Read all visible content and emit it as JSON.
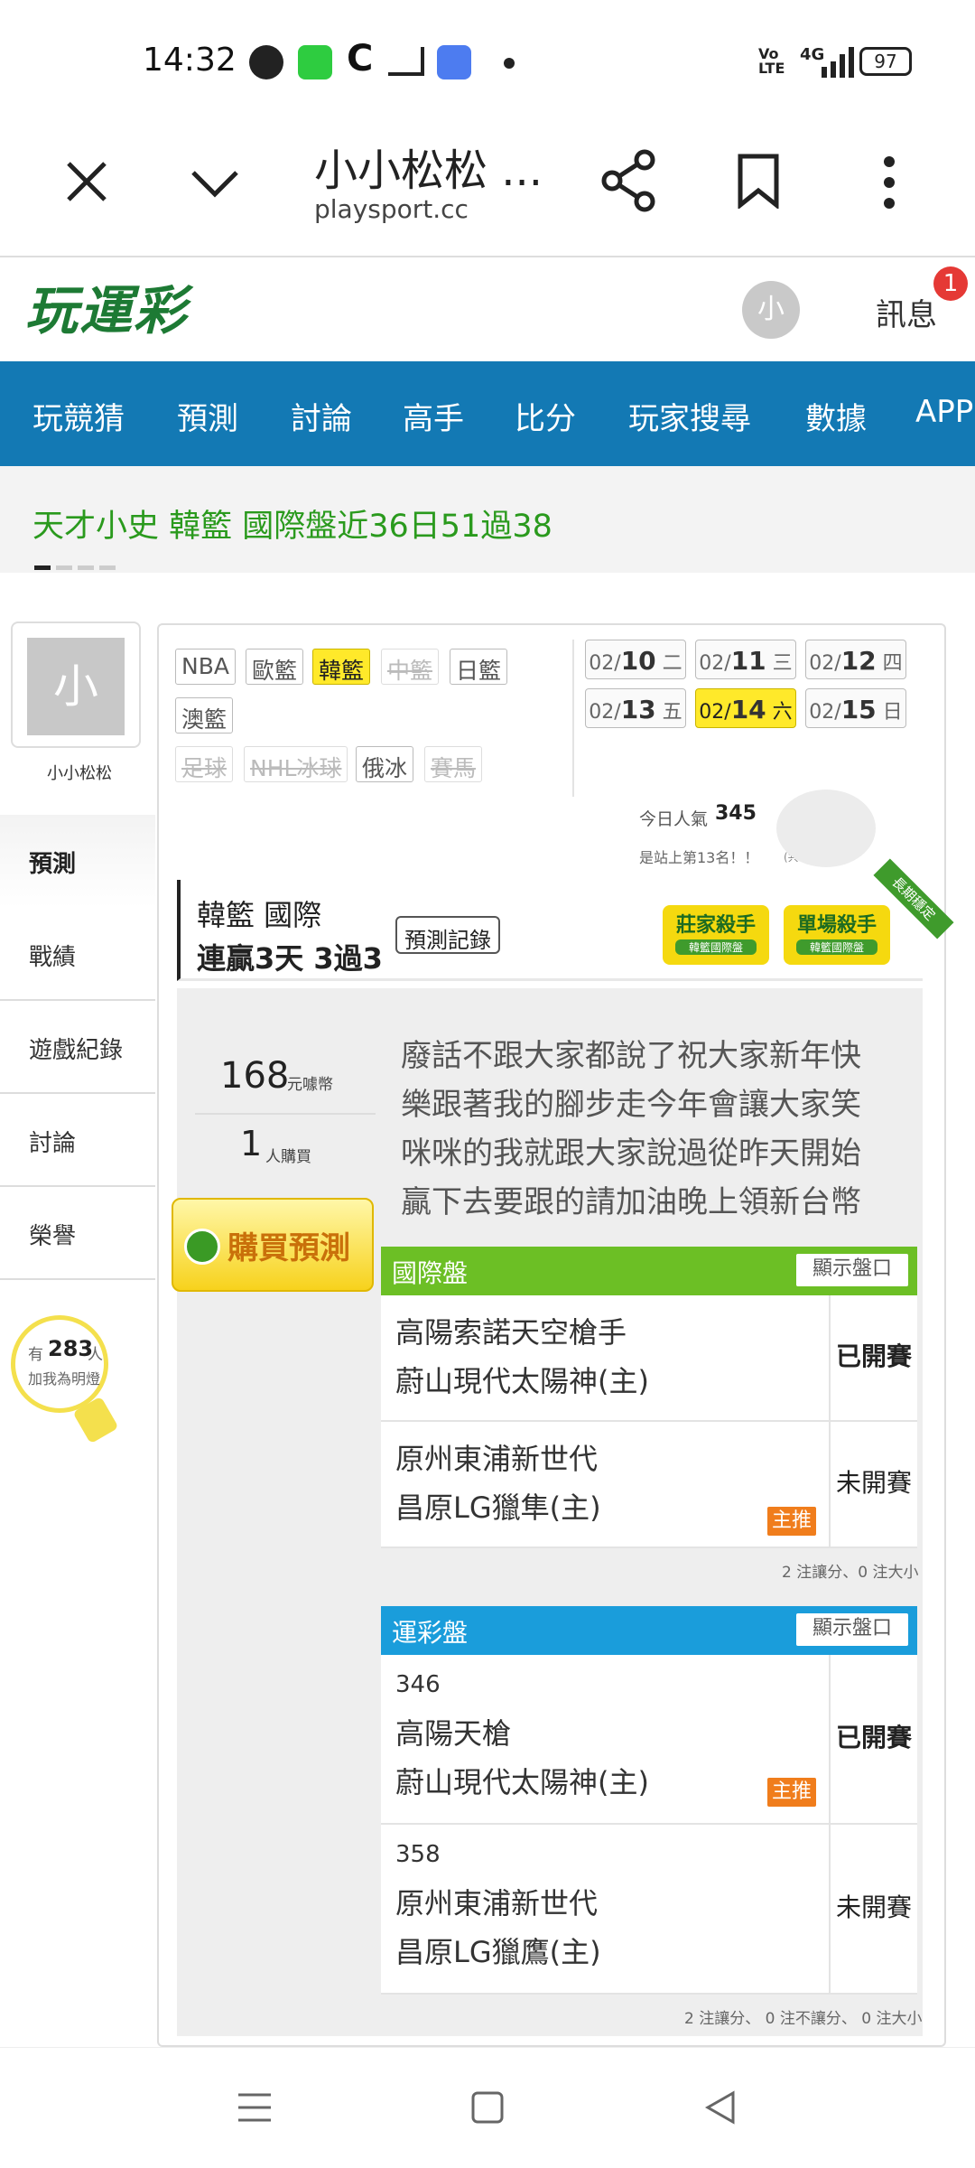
{
  "status_bar": {
    "time": "14:32",
    "battery": "97",
    "network": "4G"
  },
  "browser": {
    "title": "小小松松 ...",
    "url": "playsport.cc"
  },
  "site": {
    "logo": "玩運彩",
    "avatar_letter": "小",
    "messages_label": "訊息",
    "messages_count": "1"
  },
  "nav": {
    "items": [
      "玩競猜",
      "預測",
      "討論",
      "高手",
      "比分",
      "玩家搜尋",
      "數據",
      "APP"
    ]
  },
  "ticker": {
    "text": "天才小史  韓籃  國際盤近36日51過38"
  },
  "profile": {
    "avatar_letter": "小",
    "name": "小小松松"
  },
  "sidebar": {
    "items": [
      "預測",
      "戰績",
      "遊戲紀錄",
      "討論",
      "榮譽"
    ]
  },
  "fans": {
    "prefix": "有",
    "count": "283",
    "unit": "人",
    "label": "加我為明燈"
  },
  "leagues": [
    {
      "label": "NBA",
      "state": "normal"
    },
    {
      "label": "歐籃",
      "state": "normal"
    },
    {
      "label": "韓籃",
      "state": "selected"
    },
    {
      "label": "中籃",
      "state": "disabled"
    },
    {
      "label": "日籃",
      "state": "normal"
    },
    {
      "label": "澳籃",
      "state": "normal"
    },
    {
      "label": "足球",
      "state": "disabled"
    },
    {
      "label": "NHL冰球",
      "state": "disabled"
    },
    {
      "label": "俄冰",
      "state": "normal"
    },
    {
      "label": "賽馬",
      "state": "disabled"
    }
  ],
  "dates": [
    {
      "md": "02/",
      "day": "10",
      "wd": "二",
      "selected": false
    },
    {
      "md": "02/",
      "day": "11",
      "wd": "三",
      "selected": false
    },
    {
      "md": "02/",
      "day": "12",
      "wd": "四",
      "selected": false
    },
    {
      "md": "02/",
      "day": "13",
      "wd": "五",
      "selected": false
    },
    {
      "md": "02/",
      "day": "14",
      "wd": "六",
      "selected": true
    },
    {
      "md": "02/",
      "day": "15",
      "wd": "日",
      "selected": false
    }
  ],
  "popularity": {
    "label": "今日人氣",
    "value": "345",
    "rank_text": "是站上第13名！！",
    "rank_total": "(共6990人)"
  },
  "league_card": {
    "title": "韓籃 國際",
    "streak": "連贏3天 3過3",
    "record_button": "預測記錄",
    "badge1_top": "莊家殺手",
    "badge1_bottom": "韓籃國際盤",
    "badge2_top": "單場殺手",
    "badge2_bottom": "韓籃國際盤",
    "corner_label": "長期穩定"
  },
  "price": {
    "value": "168",
    "unit": "元噱幣",
    "buyers": "1",
    "buyers_unit": "人購買",
    "buy_button": "購買預測"
  },
  "message": "廢話不跟大家都說了祝大家新年快樂跟著我的腳步走今年會讓大家笑咪咪的我就跟大家說過從昨天開始贏下去要跟的請加油晚上領新台幣",
  "intl_board": {
    "title": "國際盤",
    "show_button": "顯示盤口",
    "rows": [
      {
        "team1": "高陽索諾天空槍手",
        "team2": "蔚山現代太陽神(主)",
        "status": "已開賽",
        "bold": true,
        "badge": ""
      },
      {
        "team1": "原州東浦新世代",
        "team2": "昌原LG獵隼(主)",
        "status": "未開賽",
        "bold": false,
        "badge": "主推"
      }
    ],
    "footer": "2 注讓分、0 注大小"
  },
  "lottery_board": {
    "title": "運彩盤",
    "show_button": "顯示盤口",
    "rows": [
      {
        "code": "346",
        "team1": "高陽天槍",
        "team2": "蔚山現代太陽神(主)",
        "status": "已開賽",
        "bold": true,
        "badge": "主推"
      },
      {
        "code": "358",
        "team1": "原州東浦新世代",
        "team2": "昌原LG獵鷹(主)",
        "status": "未開賽",
        "bold": false,
        "badge": ""
      }
    ],
    "footer": "2 注讓分、 0 注不讓分、 0 注大小"
  },
  "colors": {
    "nav_blue": "#1379b4",
    "green": "#6cbf25",
    "lottery_blue": "#1a9ddb",
    "ticker_green": "#2a9a1d",
    "badge_orange": "#f07d1c",
    "highlight_yellow": "#ffe92a"
  }
}
